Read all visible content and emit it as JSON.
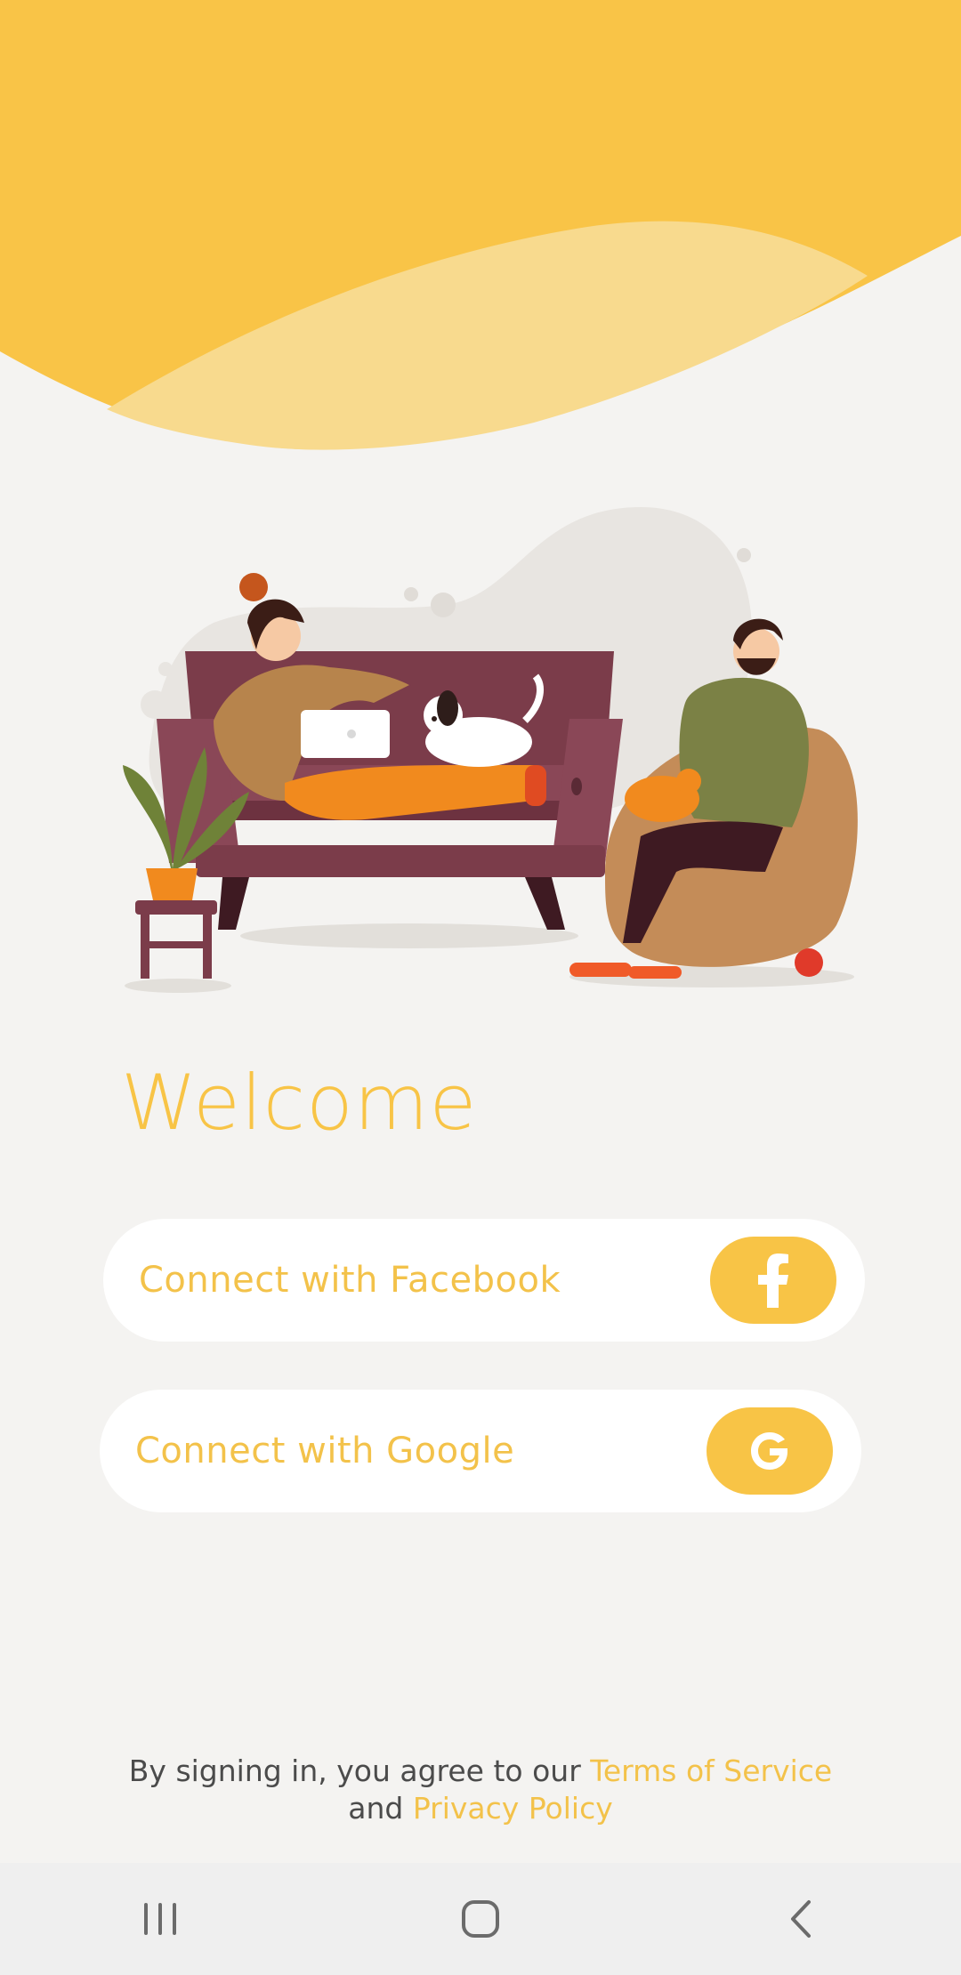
{
  "welcome": {
    "title": "Welcome"
  },
  "buttons": {
    "facebook": {
      "label": "Connect with Facebook",
      "icon": "facebook-icon"
    },
    "google": {
      "label": "Connect with Google",
      "icon": "google-icon"
    }
  },
  "legal": {
    "prefix": "By signing in, you agree to our",
    "terms": "Terms of Service",
    "conjunction": "and",
    "privacy": "Privacy Policy"
  },
  "nav_bar": {
    "recents": "recent-apps-icon",
    "home": "home-icon",
    "back": "back-icon"
  },
  "colors": {
    "accent": "#f8c446",
    "accent_light": "#f8da8e",
    "background": "#f4f3f1",
    "text": "#4b4b4b"
  }
}
